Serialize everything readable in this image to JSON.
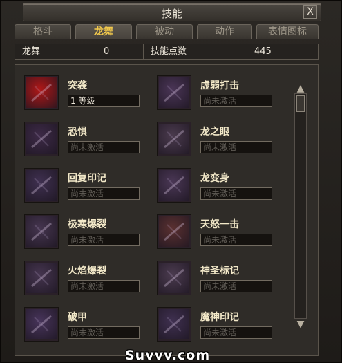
{
  "window": {
    "title": "技能",
    "close_label": "X"
  },
  "tabs": [
    {
      "label": "格斗",
      "active": false
    },
    {
      "label": "龙舞",
      "active": true
    },
    {
      "label": "被动",
      "active": false
    },
    {
      "label": "动作",
      "active": false
    },
    {
      "label": "表情图标",
      "active": false
    }
  ],
  "info": {
    "category_name": "龙舞",
    "category_points": "0",
    "skill_points_label": "技能点数",
    "skill_points_value": "445"
  },
  "skills": [
    {
      "name": "突袭",
      "status": "1  等级",
      "learned": true,
      "icon": "strike-icon",
      "color": "#b01717"
    },
    {
      "name": "虚弱打击",
      "status": "尚未激活",
      "learned": false,
      "icon": "weaken-strike-icon",
      "color": "#4a3556"
    },
    {
      "name": "恐惧",
      "status": "尚未激活",
      "learned": false,
      "icon": "fear-icon",
      "color": "#3d2a47"
    },
    {
      "name": "龙之眼",
      "status": "尚未激活",
      "learned": false,
      "icon": "dragon-eye-icon",
      "color": "#4a3a4d"
    },
    {
      "name": "回复印记",
      "status": "尚未激活",
      "learned": false,
      "icon": "recovery-mark-icon",
      "color": "#3f3050"
    },
    {
      "name": "龙变身",
      "status": "尚未激活",
      "learned": false,
      "icon": "dragon-transform-icon",
      "color": "#4a3755"
    },
    {
      "name": "极寒爆裂",
      "status": "尚未激活",
      "learned": false,
      "icon": "frost-burst-icon",
      "color": "#45354f"
    },
    {
      "name": "天怒一击",
      "status": "尚未激活",
      "learned": false,
      "icon": "heaven-wrath-icon",
      "color": "#5a3030"
    },
    {
      "name": "火焰爆裂",
      "status": "尚未激活",
      "learned": false,
      "icon": "fire-burst-icon",
      "color": "#45354f"
    },
    {
      "name": "神圣标记",
      "status": "尚未激活",
      "learned": false,
      "icon": "holy-mark-icon",
      "color": "#4b3b4f"
    },
    {
      "name": "破甲",
      "status": "尚未激活",
      "learned": false,
      "icon": "armor-break-icon",
      "color": "#47345a"
    },
    {
      "name": "魔神印记",
      "status": "尚未激活",
      "learned": false,
      "icon": "demon-mark-icon",
      "color": "#3f3050"
    }
  ],
  "scroll": {
    "up": "▲",
    "down": "▼"
  },
  "watermark": "Suvvv.com"
}
